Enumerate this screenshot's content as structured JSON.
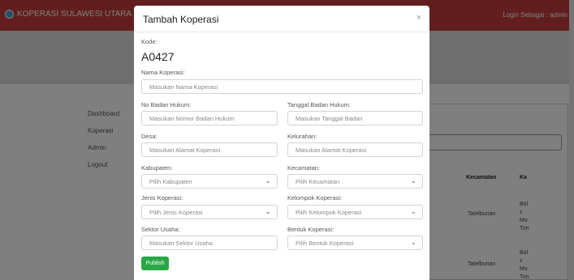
{
  "app": {
    "brand": "KOPERASI SULAWESI UTARA",
    "login": "Login Sebagai : admin"
  },
  "sidebar": {
    "items": [
      "Dashboard",
      "Koperasi",
      "Admin",
      "Logout"
    ]
  },
  "table": {
    "headers": [
      "Kecamatan",
      "Ka"
    ],
    "rows": [
      {
        "kecamatan": "Tatelbunan",
        "col": "Bolz Mo Tim"
      },
      {
        "kecamatan": "Tatelbunan",
        "col": "Bolz Mo Tim"
      }
    ]
  },
  "modal": {
    "title": "Tambah Koperasi",
    "close": "×",
    "kode_label": "Kode:",
    "kode_value": "A0427",
    "fields": {
      "nama": {
        "label": "Nama Koperasi:",
        "placeholder": "Masukan Nama Koperasi"
      },
      "no_badan": {
        "label": "No Badan Hukum:",
        "placeholder": "Masukan Nomor Badan Hukum"
      },
      "tgl_badan": {
        "label": "Tanggal Badan Hukum:",
        "placeholder": "Masukan Tanggal Badan"
      },
      "desa": {
        "label": "Desa:",
        "placeholder": "Masukan Alamat Koperasi"
      },
      "kelurahan": {
        "label": "Kelurahan:",
        "placeholder": "Masukan Alamat Koperasi"
      },
      "kabupaten": {
        "label": "Kabupaten:",
        "value": "Pilih Kabupaten"
      },
      "kecamatan": {
        "label": "Kecamatan:",
        "value": "Pilih Kecamatan"
      },
      "jenis": {
        "label": "Jenis Koperasi:",
        "value": "Pilih Jenis Koperasi"
      },
      "kelompok": {
        "label": "Kelompok Koperasi:",
        "value": "Pilih Kelompok Koperasi"
      },
      "sektor": {
        "label": "Sektor Usaha:",
        "placeholder": "Masukan Sektor Usaha"
      },
      "bentuk": {
        "label": "Bentuk Koperasi:",
        "value": "Pilih Bentuk Koperasi"
      }
    },
    "publish": "Publish"
  }
}
